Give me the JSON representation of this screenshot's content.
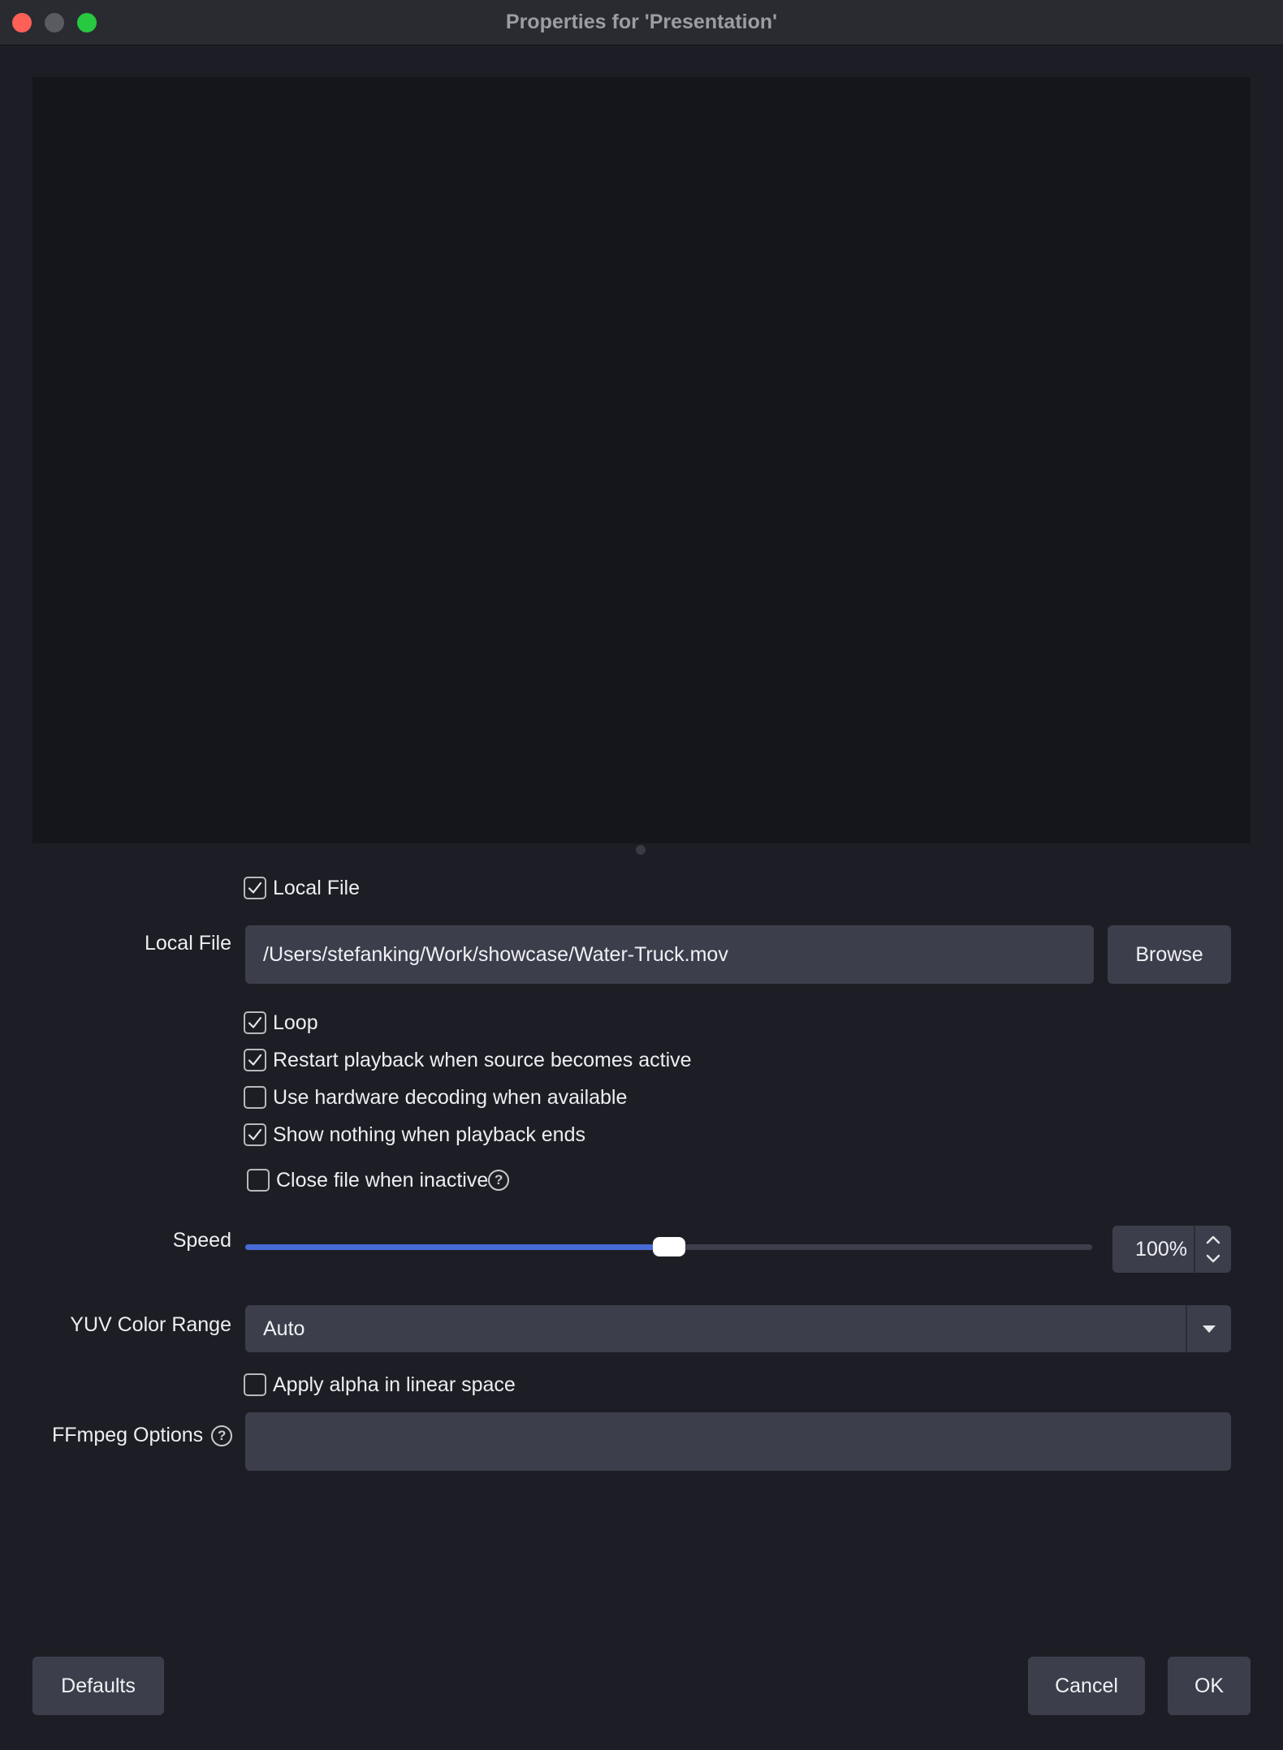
{
  "window": {
    "title": "Properties for 'Presentation'"
  },
  "local_file_checkbox": {
    "label": "Local File",
    "checked": true
  },
  "local_file": {
    "label": "Local File",
    "value": "/Users/stefanking/Work/showcase/Water-Truck.mov",
    "browse_label": "Browse"
  },
  "options": [
    {
      "label": "Loop",
      "checked": true
    },
    {
      "label": "Restart playback when source becomes active",
      "checked": true
    },
    {
      "label": "Use hardware decoding when available",
      "checked": false
    },
    {
      "label": "Show nothing when playback ends",
      "checked": true
    }
  ],
  "close_file": {
    "label": "Close file when inactive",
    "checked": false
  },
  "speed": {
    "label": "Speed",
    "value": "100%",
    "slider_fraction": 0.5
  },
  "yuv": {
    "label": "YUV Color Range",
    "value": "Auto"
  },
  "apply_alpha": {
    "label": "Apply alpha in linear space",
    "checked": false
  },
  "ffmpeg": {
    "label": "FFmpeg Options",
    "value": ""
  },
  "buttons": {
    "defaults": "Defaults",
    "cancel": "Cancel",
    "ok": "OK"
  },
  "colors": {
    "accent": "#476bd6",
    "background": "#1d1e25",
    "field": "#3c3f4b"
  },
  "icons": {
    "check": "checkmark-icon",
    "help": "help-circle-icon",
    "dropdown": "triangle-down-icon",
    "spin_up": "chevron-up-icon",
    "spin_down": "chevron-down-icon"
  }
}
